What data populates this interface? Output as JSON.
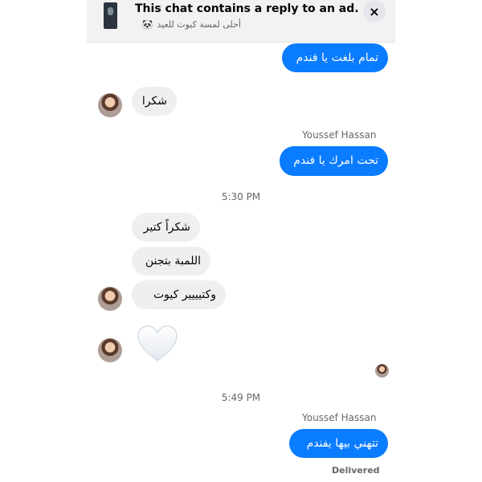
{
  "banner": {
    "title": "This chat contains a reply to an ad.",
    "subtitle": "أحلى لمسة كيوت للعيد",
    "close_label": "×",
    "subtitle_icon": "panda-icon"
  },
  "messages": [
    {
      "id": "m1",
      "direction": "outgoing",
      "text": "تمام بلغت يا فندم"
    },
    {
      "id": "m2",
      "direction": "incoming",
      "text": "شكرا"
    },
    {
      "id": "m3",
      "direction": "outgoing",
      "sender": "Youssef Hassan",
      "text": "تحت امرك يا فندم"
    },
    {
      "id": "m4",
      "direction": "incoming",
      "text": "شكراً كتير"
    },
    {
      "id": "m5",
      "direction": "incoming",
      "text": "اللمبة بتجنن"
    },
    {
      "id": "m6",
      "direction": "incoming",
      "text": "وكتيييير كيوت"
    },
    {
      "id": "m7",
      "direction": "incoming",
      "reaction": "white-heart"
    },
    {
      "id": "m8",
      "direction": "outgoing",
      "sender": "Youssef Hassan",
      "text": "تتهني بيها يفندم"
    }
  ],
  "timestamps": [
    "5:30 PM",
    "5:49 PM"
  ],
  "senders": {
    "outgoing_name": "Youssef Hassan"
  },
  "status": {
    "delivered": "Delivered"
  },
  "colors": {
    "outgoing_bubble": "#0a7cff",
    "incoming_bubble": "#efefef",
    "banner_bg": "#f2f2f2"
  }
}
